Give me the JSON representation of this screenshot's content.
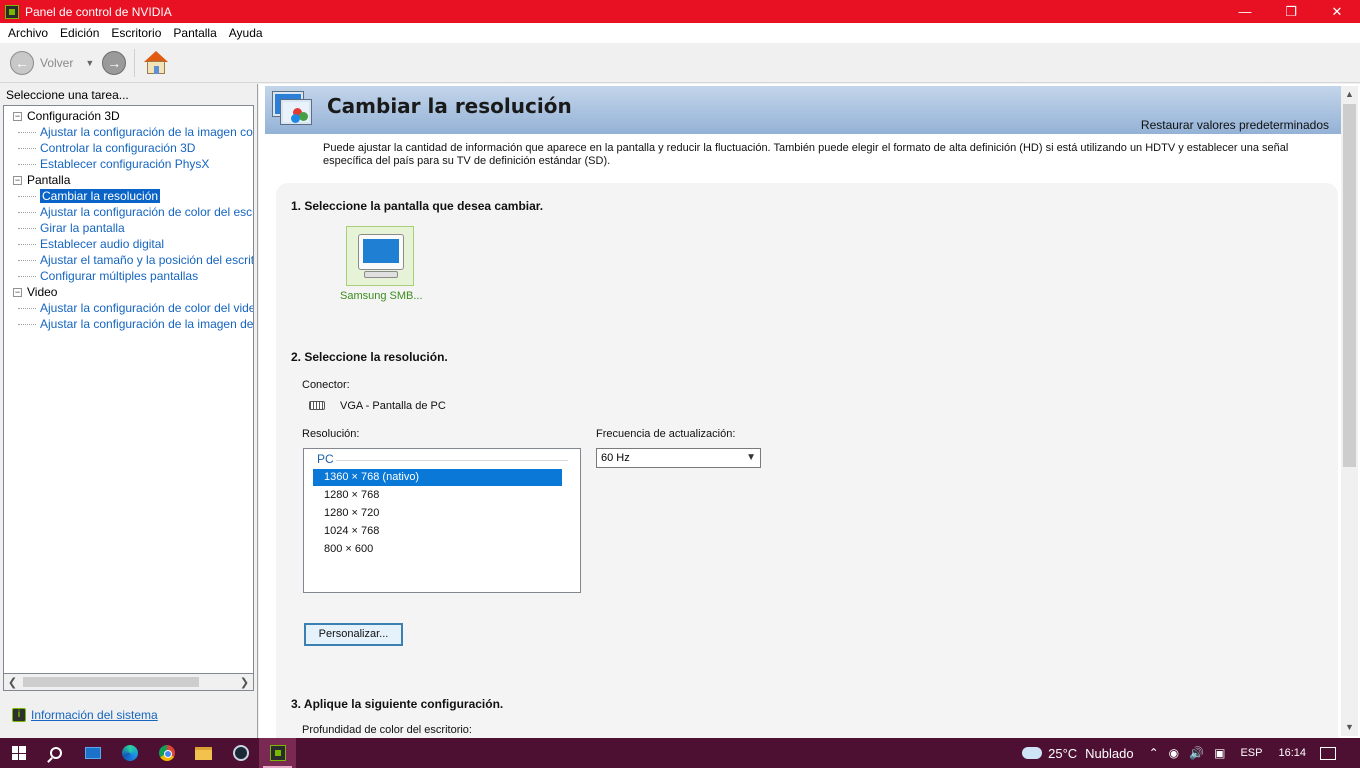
{
  "window": {
    "title": "Panel de control de NVIDIA",
    "minimize_glyph": "—",
    "maximize_glyph": "❐",
    "close_glyph": "✕"
  },
  "menu": [
    "Archivo",
    "Edición",
    "Escritorio",
    "Pantalla",
    "Ayuda"
  ],
  "toolbar": {
    "back_label": "Volver"
  },
  "left": {
    "task_label": "Seleccione una tarea...",
    "tree": [
      {
        "label": "Configuración 3D",
        "children": [
          "Ajustar la configuración de la imagen con v",
          "Controlar la configuración 3D",
          "Establecer configuración PhysX"
        ]
      },
      {
        "label": "Pantalla",
        "children": [
          "Cambiar la resolución",
          "Ajustar la configuración de color del escrito",
          "Girar la pantalla",
          "Establecer audio digital",
          "Ajustar el tamaño y la posición del escritorio",
          "Configurar múltiples pantallas"
        ]
      },
      {
        "label": "Video",
        "children": [
          "Ajustar la configuración de color del video",
          "Ajustar la configuración de la imagen de vic"
        ]
      }
    ],
    "selected_item": "Cambiar la resolución",
    "system_info_link": "Información del sistema"
  },
  "main": {
    "title": "Cambiar la resolución",
    "restore_link": "Restaurar valores predeterminados",
    "description": "Puede ajustar la cantidad de información que aparece en la pantalla y reducir la fluctuación. También puede elegir el formato de alta definición (HD) si está utilizando un HDTV y establecer una señal específica del país para su TV de definición estándar (SD).",
    "step1": "1. Seleccione la pantalla que desea cambiar.",
    "display_name": "Samsung SMB...",
    "step2": "2. Seleccione la resolución.",
    "connector_label": "Conector:",
    "connector_value": "VGA - Pantalla de PC",
    "resolution_label": "Resolución:",
    "resolution_group": "PC",
    "resolutions": [
      "1360 × 768 (nativo)",
      "1280 × 768",
      "1280 × 720",
      "1024 × 768",
      "800 × 600"
    ],
    "selected_resolution": "1360 × 768 (nativo)",
    "refresh_label": "Frecuencia de actualización:",
    "refresh_value": "60 Hz",
    "customize_button": "Personalizar...",
    "step3": "3. Aplique la siguiente configuración.",
    "color_depth_label": "Profundidad de color del escritorio:"
  },
  "taskbar": {
    "weather_temp": "25°C",
    "weather_condition": "Nublado",
    "language": "ESP",
    "time": "16:14"
  },
  "colors": {
    "titlebar": "#e81123",
    "header_gradient": "#94b2d6",
    "selection": "#0a78d7",
    "link": "#1565c0",
    "display_name": "#3c8c1e",
    "taskbar": "#4e1032"
  },
  "icons": [
    "nvidia-app-icon",
    "back-arrow-icon",
    "forward-arrow-icon",
    "home-icon",
    "display-monitor-icon",
    "vga-connector-icon",
    "system-info-icon",
    "windows-start-icon",
    "search-icon",
    "mail-icon",
    "edge-icon",
    "chrome-icon",
    "file-explorer-icon",
    "steam-icon",
    "nvidia-taskbar-icon",
    "weather-icon",
    "notification-icon"
  ]
}
